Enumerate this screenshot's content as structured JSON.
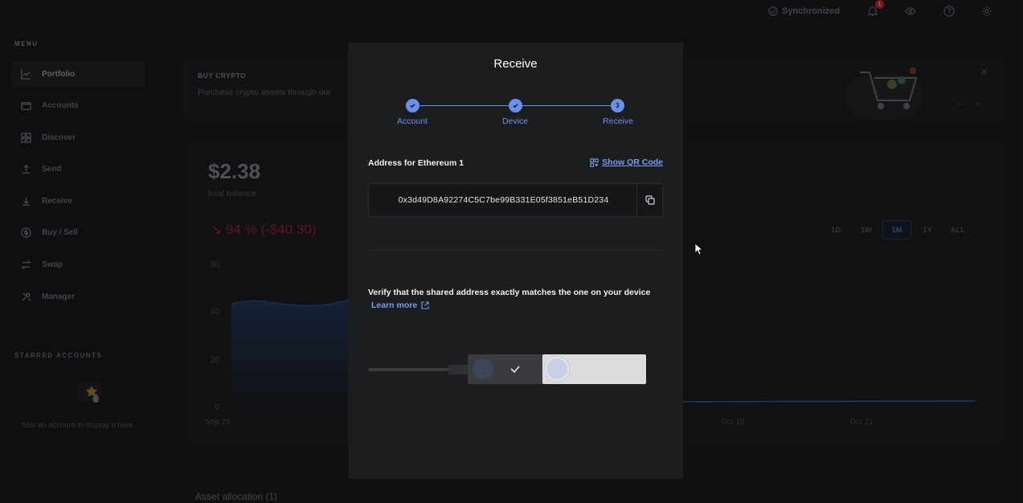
{
  "sidebar": {
    "menu_title": "MENU",
    "items": [
      {
        "label": "Portfolio",
        "icon": "chart-line-icon"
      },
      {
        "label": "Accounts",
        "icon": "wallet-icon"
      },
      {
        "label": "Discover",
        "icon": "grid-icon"
      },
      {
        "label": "Send",
        "icon": "arrow-up-icon"
      },
      {
        "label": "Receive",
        "icon": "arrow-down-icon"
      },
      {
        "label": "Buy / Sell",
        "icon": "dollar-icon"
      },
      {
        "label": "Swap",
        "icon": "swap-icon"
      },
      {
        "label": "Manager",
        "icon": "tools-icon"
      }
    ],
    "starred_title": "STARRED ACCOUNTS",
    "starred_hint": "Star an account to display it here."
  },
  "topbar": {
    "sync_label": "Synchronized",
    "notification_count": "1"
  },
  "banner": {
    "title": "BUY CRYPTO",
    "description": "Purchase crypto assets through our"
  },
  "portfolio": {
    "balance": "$2.38",
    "balance_label": "total balance",
    "delta": "94 % (-$40.30)",
    "ranges": [
      "1D",
      "1W",
      "1M",
      "1Y",
      "ALL"
    ],
    "active_range": "1M",
    "y_ticks": [
      "60",
      "40",
      "20",
      "0"
    ],
    "x_ticks": [
      "Sep 26",
      "Oct 16",
      "Oct 21"
    ]
  },
  "asset_allocation": "Asset allocation (1)",
  "modal": {
    "title": "Receive",
    "steps": [
      "Account",
      "Device",
      "Receive"
    ],
    "current_step": "3",
    "address_label": "Address for Ethereum 1",
    "show_qr_label": "Show QR Code",
    "address": "0x3d49D8A92274C5C7be99B331E05f3851eB51D234",
    "verify_text": "Verify that the shared address exactly matches the one on your device",
    "learn_more": "Learn more"
  },
  "colors": {
    "accent": "#6b90ec",
    "negative": "#6a1c1e",
    "modal_bg": "#1c1d1f"
  }
}
